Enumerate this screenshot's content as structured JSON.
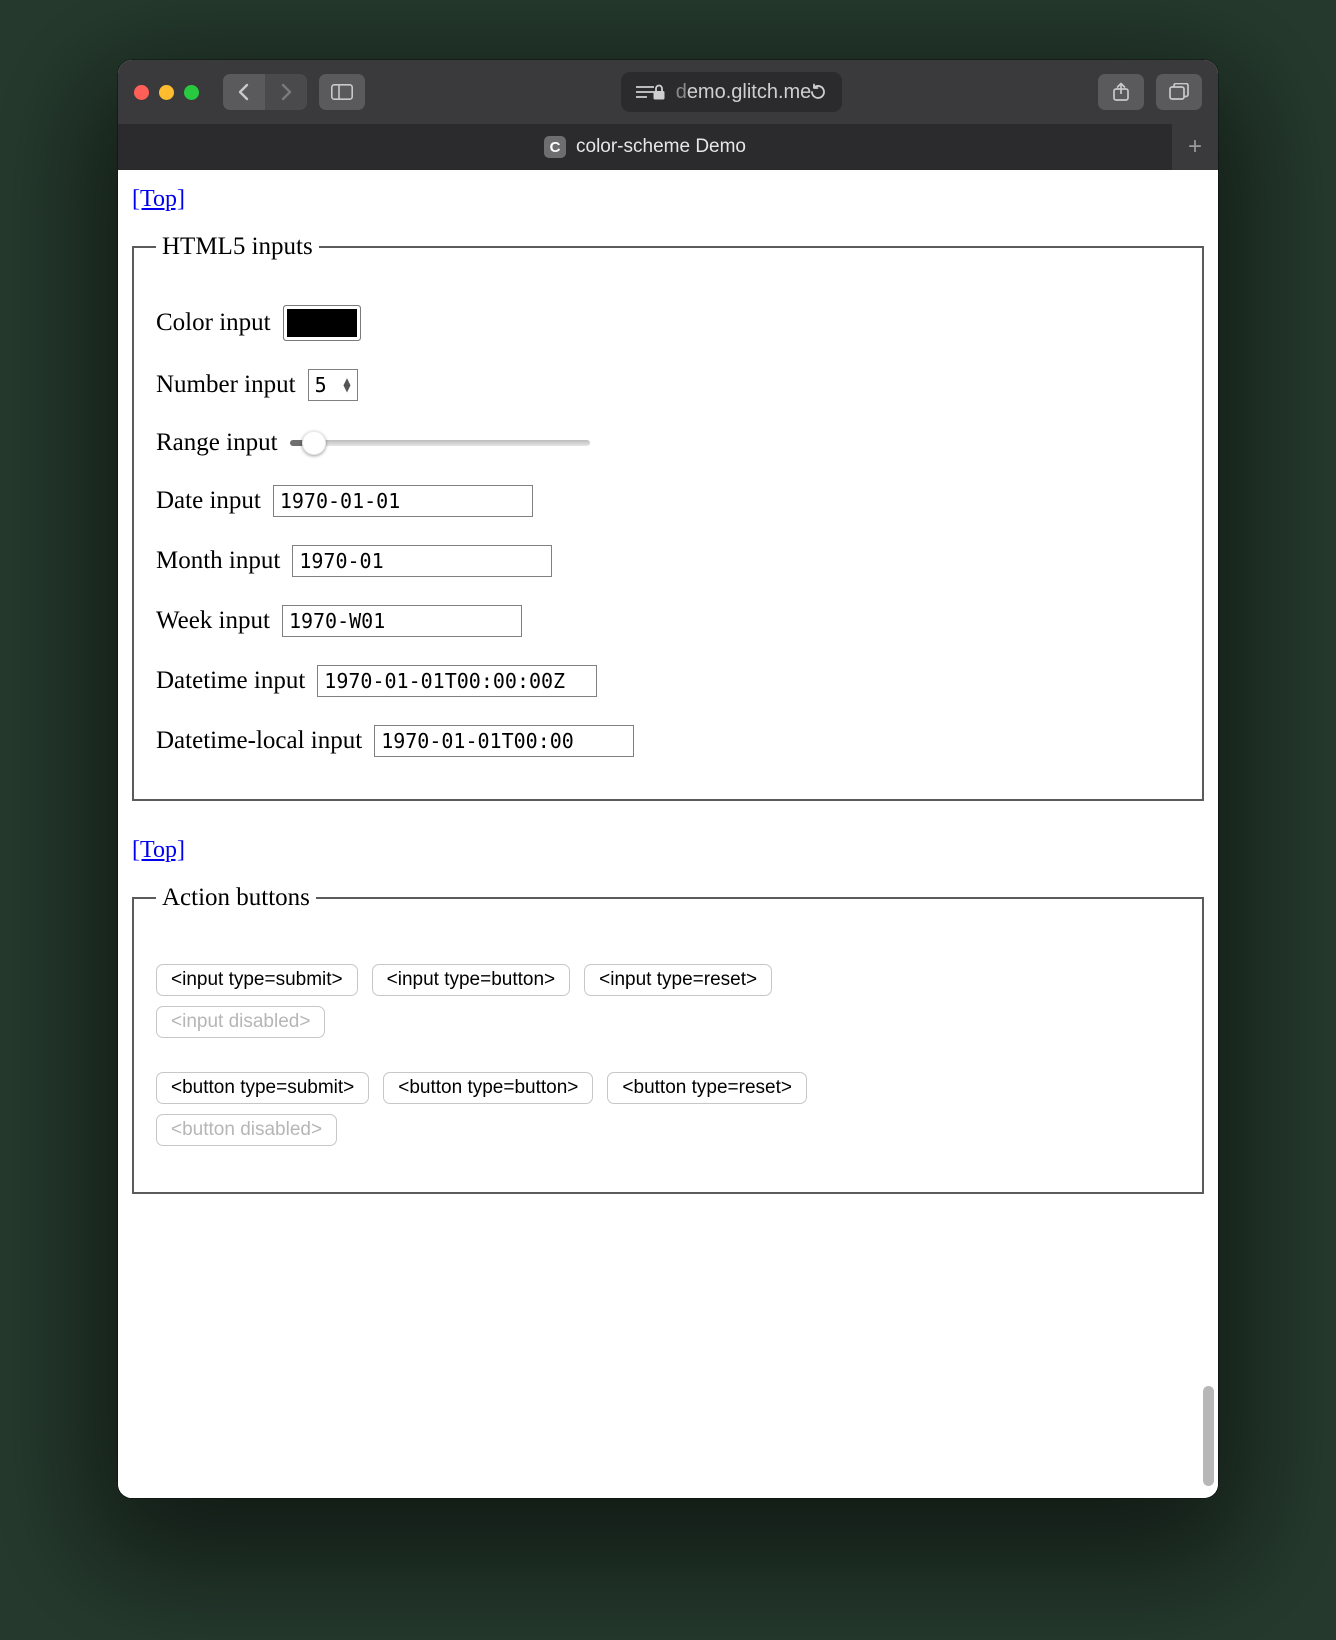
{
  "browser": {
    "url_domain_dim_prefix": "d",
    "url_domain": "emo.glitch.me",
    "tab_title": "color-scheme Demo",
    "tab_favicon_letter": "C"
  },
  "links": {
    "top": "[Top]"
  },
  "fieldset1": {
    "legend": "HTML5 inputs",
    "color": {
      "label": "Color input",
      "value": "#000000"
    },
    "number": {
      "label": "Number input",
      "value": "5"
    },
    "range": {
      "label": "Range input",
      "value": 10,
      "min": 0,
      "max": 100
    },
    "date": {
      "label": "Date input",
      "value": "1970-01-01"
    },
    "month": {
      "label": "Month input",
      "value": "1970-01"
    },
    "week": {
      "label": "Week input",
      "value": "1970-W01"
    },
    "datetime": {
      "label": "Datetime input",
      "value": "1970-01-01T00:00:00Z"
    },
    "datetime_local": {
      "label": "Datetime-local input",
      "value": "1970-01-01T00:00"
    }
  },
  "fieldset2": {
    "legend": "Action buttons",
    "inputs": {
      "submit": "<input type=submit>",
      "button": "<input type=button>",
      "reset": "<input type=reset>",
      "disabled": "<input disabled>"
    },
    "buttons": {
      "submit": "<button type=submit>",
      "button": "<button type=button>",
      "reset": "<button type=reset>",
      "disabled": "<button disabled>"
    }
  }
}
